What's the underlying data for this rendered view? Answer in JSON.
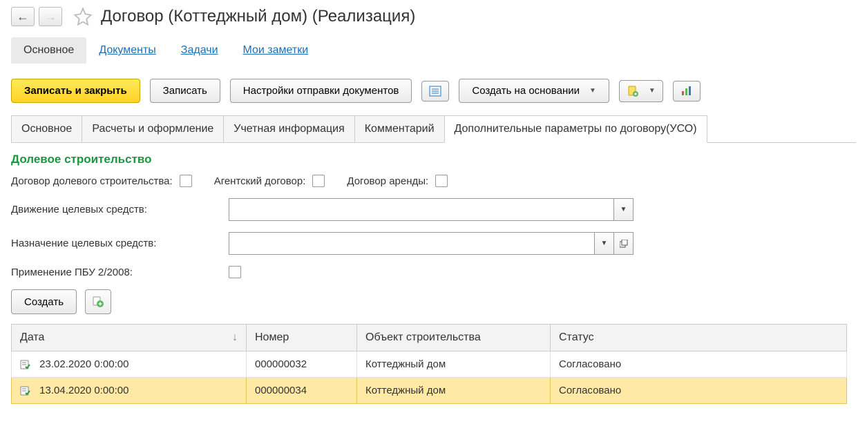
{
  "title": "Договор (Коттеджный дом) (Реализация)",
  "nav_tabs": {
    "main": "Основное",
    "documents": "Документы",
    "tasks": "Задачи",
    "notes": "Мои заметки"
  },
  "toolbar": {
    "save_close": "Записать и закрыть",
    "save": "Записать",
    "send_settings": "Настройки отправки документов",
    "create_based_on": "Создать на основании"
  },
  "form_tabs": {
    "t1": "Основное",
    "t2": "Расчеты и оформление",
    "t3": "Учетная информация",
    "t4": "Комментарий",
    "t5": "Дополнительные параметры по договору(УСО)"
  },
  "section_title": "Долевое строительство",
  "checkboxes": {
    "shared_construction": "Договор долевого строительства:",
    "agent_contract": "Агентский договор:",
    "rent_contract": "Договор аренды:"
  },
  "fields": {
    "target_movement": "Движение целевых средств:",
    "target_purpose": "Назначение целевых средств:",
    "pbu": "Применение ПБУ 2/2008:"
  },
  "sub_toolbar": {
    "create": "Создать"
  },
  "table": {
    "headers": {
      "date": "Дата",
      "number": "Номер",
      "object": "Объект строительства",
      "status": "Статус"
    },
    "rows": [
      {
        "date": "23.02.2020 0:00:00",
        "number": "000000032",
        "object": "Коттеджный дом",
        "status": "Согласовано"
      },
      {
        "date": "13.04.2020 0:00:00",
        "number": "000000034",
        "object": "Коттеджный дом",
        "status": "Согласовано"
      }
    ]
  }
}
